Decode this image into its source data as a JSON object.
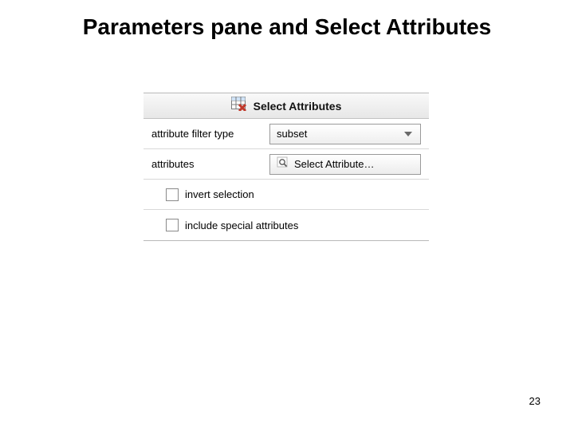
{
  "slide": {
    "title": "Parameters pane and Select Attributes",
    "page_number": "23"
  },
  "panel": {
    "header_title": "Select Attributes",
    "row1_label": "attribute filter type",
    "row1_value": "subset",
    "row2_label": "attributes",
    "row2_button": "Select Attribute…",
    "row3_label": "invert selection",
    "row4_label": "include special attributes"
  }
}
